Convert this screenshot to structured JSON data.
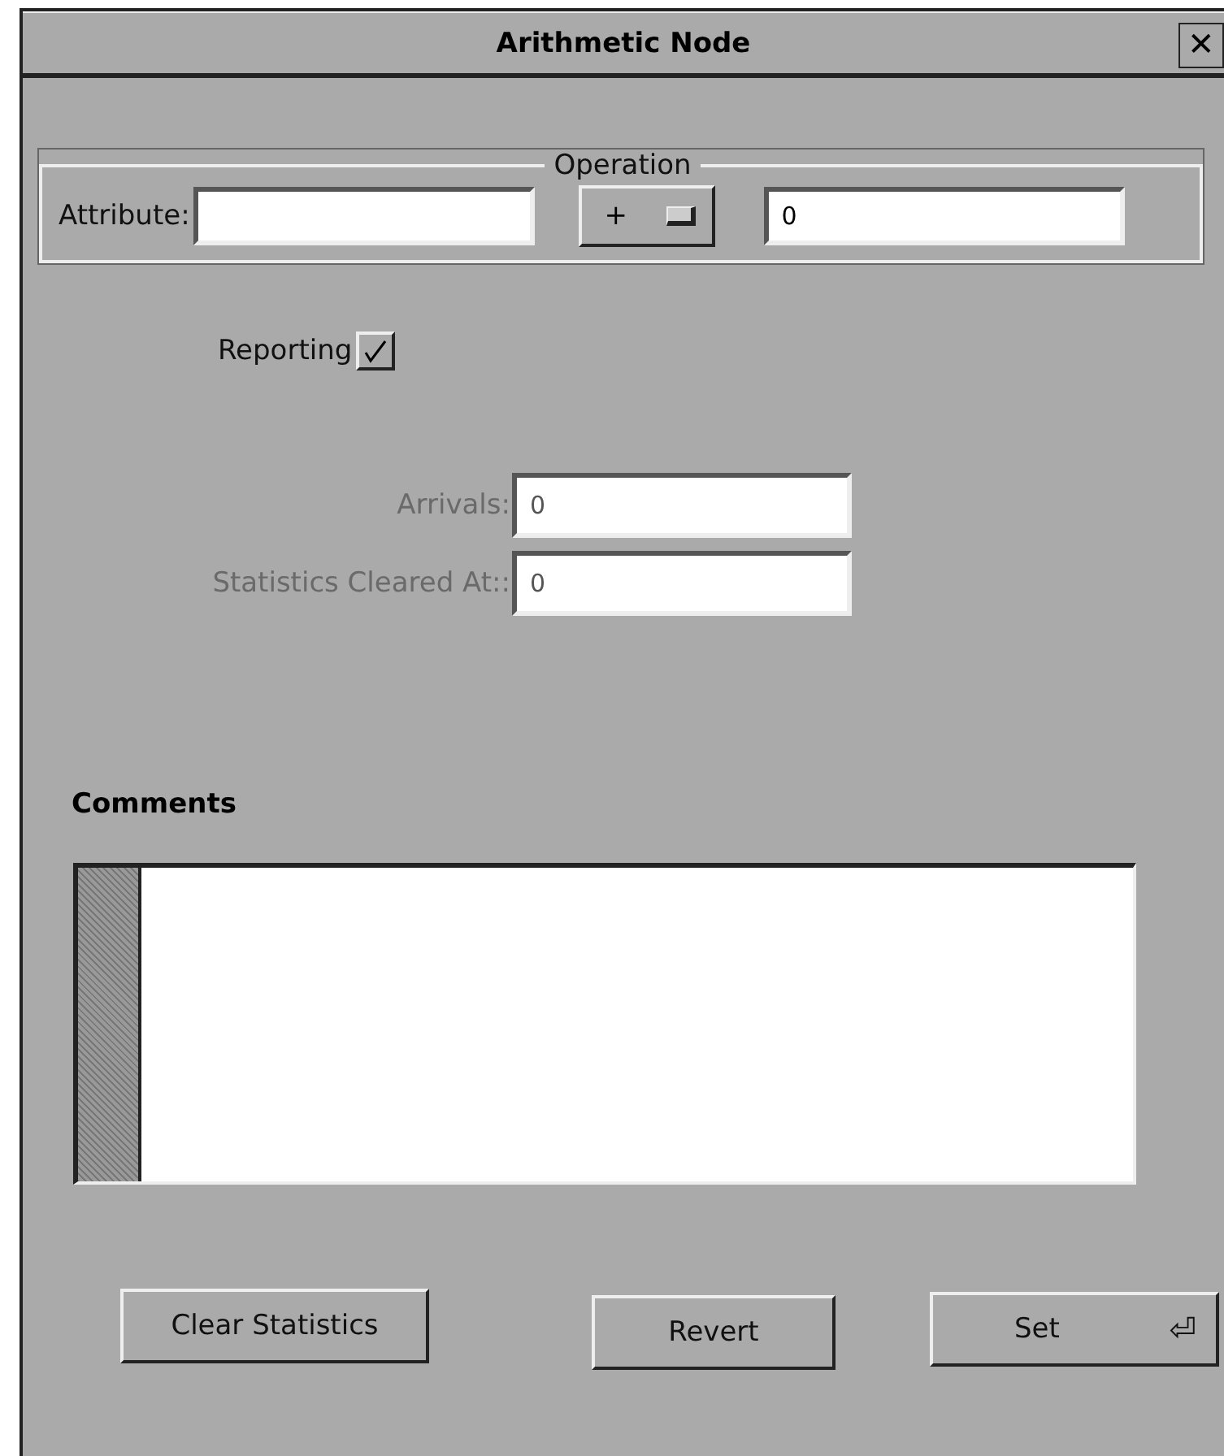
{
  "window": {
    "title": "Arithmetic Node",
    "close": "✕"
  },
  "operation": {
    "legend": "Operation",
    "attribute_label": "Attribute:",
    "operator": "+",
    "operand": "0"
  },
  "reporting": {
    "label": "Reporting",
    "checked": true
  },
  "statistics": [
    {
      "label": "Arrivals:",
      "value": "0",
      "disabled": true
    },
    {
      "label": "Statistics Cleared At::",
      "value": "0",
      "disabled": true
    }
  ],
  "comments": {
    "label": "Comments"
  },
  "buttons": [
    {
      "label": "Clear Statistics",
      "kind": "plain"
    },
    {
      "label": "Revert",
      "kind": "plain"
    },
    {
      "label": "Set",
      "kind": "default",
      "glyph": "⏎"
    }
  ]
}
